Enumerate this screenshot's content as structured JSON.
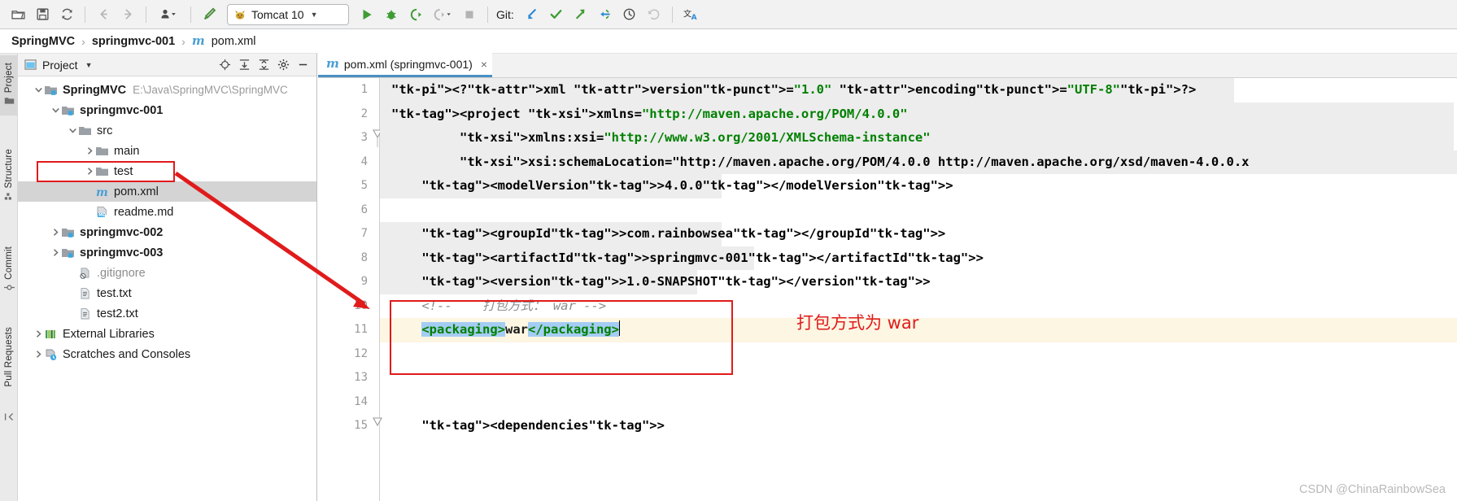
{
  "app": {
    "name": "IntelliJ IDEA"
  },
  "toolbar": {
    "buttons": [
      {
        "name": "open-folder-icon",
        "tooltip": "Open"
      },
      {
        "name": "save-all-icon",
        "tooltip": "Save All"
      },
      {
        "name": "sync-refresh-icon",
        "tooltip": "Synchronize"
      },
      {
        "name": "back-arrow-icon",
        "tooltip": "Back"
      },
      {
        "name": "forward-arrow-icon",
        "tooltip": "Forward"
      },
      {
        "name": "profiler-user-icon",
        "tooltip": "Profiler"
      },
      {
        "name": "build-hammer-icon",
        "tooltip": "Build Project"
      }
    ],
    "run_config": {
      "label": "Tomcat 10",
      "icon": "tomcat-cat-icon"
    },
    "run_buttons": [
      {
        "name": "run-button",
        "tooltip": "Run"
      },
      {
        "name": "debug-button",
        "tooltip": "Debug"
      },
      {
        "name": "run-coverage-button",
        "tooltip": "Run with Coverage"
      },
      {
        "name": "profile-button",
        "tooltip": "Profile"
      },
      {
        "name": "stop-button",
        "tooltip": "Stop"
      }
    ],
    "git": {
      "label": "Git:",
      "actions": [
        {
          "name": "git-update-icon",
          "tooltip": "Update Project"
        },
        {
          "name": "git-commit-icon",
          "tooltip": "Commit"
        },
        {
          "name": "git-push-icon",
          "tooltip": "Push"
        },
        {
          "name": "git-pull-request-icon",
          "tooltip": "Pull Requests"
        },
        {
          "name": "git-history-icon",
          "tooltip": "History"
        },
        {
          "name": "git-rollback-icon",
          "tooltip": "Rollback"
        },
        {
          "name": "translate-icon",
          "tooltip": "Translate"
        }
      ]
    }
  },
  "breadcrumb": {
    "items": [
      {
        "label": "SpringMVC",
        "bold": true,
        "icon": null
      },
      {
        "label": "springmvc-001",
        "bold": true,
        "icon": null
      },
      {
        "label": "pom.xml",
        "bold": false,
        "icon": "maven-m-icon"
      }
    ],
    "separator": "›"
  },
  "rail": {
    "items": [
      {
        "label": "Project",
        "icon": "project-icon",
        "active": true
      },
      {
        "label": "Structure",
        "icon": "structure-icon",
        "active": false
      },
      {
        "label": "Commit",
        "icon": "commit-icon",
        "active": false
      },
      {
        "label": "Pull Requests",
        "icon": "pull-requests-icon",
        "active": false
      }
    ]
  },
  "project_panel": {
    "title": "Project",
    "tools": [
      {
        "name": "locate-target-icon"
      },
      {
        "name": "expand-all-icon"
      },
      {
        "name": "collapse-all-icon"
      },
      {
        "name": "settings-gear-icon"
      },
      {
        "name": "hide-panel-icon"
      }
    ],
    "tree": [
      {
        "label": "SpringMVC",
        "path": "E:\\Java\\SpringMVC\\SpringMVC",
        "indent": 0,
        "arrow": "down",
        "icon": "module-folder-icon",
        "bold": true,
        "selected": false
      },
      {
        "label": "springmvc-001",
        "path": "",
        "indent": 1,
        "arrow": "down",
        "icon": "module-folder-icon",
        "bold": true,
        "selected": false
      },
      {
        "label": "src",
        "path": "",
        "indent": 2,
        "arrow": "down",
        "icon": "folder-icon",
        "bold": false,
        "selected": false
      },
      {
        "label": "main",
        "path": "",
        "indent": 3,
        "arrow": "right",
        "icon": "folder-icon",
        "bold": false,
        "selected": false
      },
      {
        "label": "test",
        "path": "",
        "indent": 3,
        "arrow": "right",
        "icon": "folder-icon",
        "bold": false,
        "selected": false
      },
      {
        "label": "pom.xml",
        "path": "",
        "indent": 3,
        "arrow": "none",
        "icon": "maven-m-icon",
        "bold": false,
        "selected": true
      },
      {
        "label": "readme.md",
        "path": "",
        "indent": 3,
        "arrow": "none",
        "icon": "markdown-icon",
        "bold": false,
        "selected": false
      },
      {
        "label": "springmvc-002",
        "path": "",
        "indent": 1,
        "arrow": "right",
        "icon": "module-folder-icon",
        "bold": true,
        "selected": false
      },
      {
        "label": "springmvc-003",
        "path": "",
        "indent": 1,
        "arrow": "right",
        "icon": "module-folder-icon",
        "bold": true,
        "selected": false
      },
      {
        "label": ".gitignore",
        "path": "",
        "indent": 2,
        "arrow": "none",
        "icon": "gitignore-icon",
        "bold": false,
        "selected": false,
        "gray": true
      },
      {
        "label": "test.txt",
        "path": "",
        "indent": 2,
        "arrow": "none",
        "icon": "text-file-icon",
        "bold": false,
        "selected": false
      },
      {
        "label": "test2.txt",
        "path": "",
        "indent": 2,
        "arrow": "none",
        "icon": "text-file-icon",
        "bold": false,
        "selected": false
      },
      {
        "label": "External Libraries",
        "path": "",
        "indent": 0,
        "arrow": "right",
        "icon": "libraries-icon",
        "bold": false,
        "selected": false
      },
      {
        "label": "Scratches and Consoles",
        "path": "",
        "indent": 0,
        "arrow": "right",
        "icon": "scratches-icon",
        "bold": false,
        "selected": false
      }
    ]
  },
  "editor": {
    "tab": {
      "label": "pom.xml (springmvc-001)",
      "icon": "maven-m-icon",
      "close": "×"
    },
    "lines": [
      {
        "no": "1",
        "text": "<?xml version=\"1.0\" encoding=\"UTF-8\"?>"
      },
      {
        "no": "2",
        "text": "<project xmlns=\"http://maven.apache.org/POM/4.0.0\""
      },
      {
        "no": "3",
        "text": "         xmlns:xsi=\"http://www.w3.org/2001/XMLSchema-instance\""
      },
      {
        "no": "4",
        "text": "         xsi:schemaLocation=\"http://maven.apache.org/POM/4.0.0 http://maven.apache.org/xsd/maven-4.0.0.x"
      },
      {
        "no": "5",
        "text": "    <modelVersion>4.0.0</modelVersion>"
      },
      {
        "no": "6",
        "text": ""
      },
      {
        "no": "7",
        "text": "    <groupId>com.rainbowsea</groupId>"
      },
      {
        "no": "8",
        "text": "    <artifactId>springmvc-001</artifactId>"
      },
      {
        "no": "9",
        "text": "    <version>1.0-SNAPSHOT</version>"
      },
      {
        "no": "10",
        "text": "    <!--    打包方式： war -->"
      },
      {
        "no": "11",
        "text": "    <packaging>war</packaging>"
      },
      {
        "no": "12",
        "text": ""
      },
      {
        "no": "13",
        "text": ""
      },
      {
        "no": "14",
        "text": ""
      },
      {
        "no": "15",
        "text": "    <dependencies>"
      }
    ]
  },
  "annotations": {
    "red_note": "打包方式为 war",
    "watermark": "CSDN @ChinaRainbowSea",
    "accent_red": "#e01b1b"
  }
}
